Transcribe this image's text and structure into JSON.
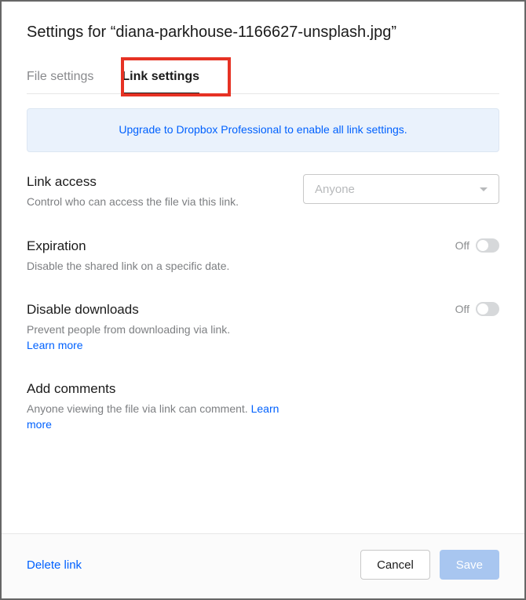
{
  "title": "Settings for “diana-parkhouse-1166627-unsplash.jpg”",
  "tabs": {
    "file_settings": "File settings",
    "link_settings": "Link settings"
  },
  "banner": {
    "text": "Upgrade to Dropbox Professional to enable all link settings."
  },
  "link_access": {
    "title": "Link access",
    "desc": "Control who can access the file via this link.",
    "dropdown_value": "Anyone"
  },
  "expiration": {
    "title": "Expiration",
    "desc": "Disable the shared link on a specific date.",
    "toggle_state": "Off"
  },
  "disable_downloads": {
    "title": "Disable downloads",
    "desc": "Prevent people from downloading via link.",
    "learn_more": "Learn more",
    "toggle_state": "Off"
  },
  "add_comments": {
    "title": "Add comments",
    "desc_prefix": "Anyone viewing the file via link can comment. ",
    "learn_more": "Learn more"
  },
  "footer": {
    "delete_link": "Delete link",
    "cancel": "Cancel",
    "save": "Save"
  }
}
